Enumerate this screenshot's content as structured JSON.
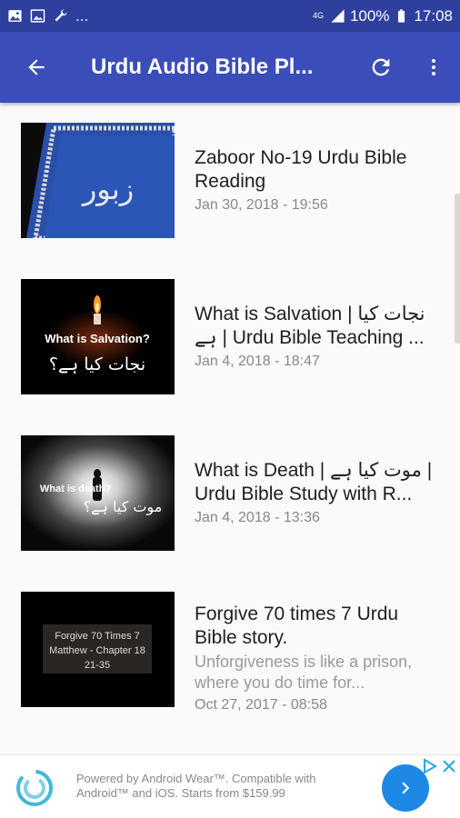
{
  "status_bar": {
    "network": "4G",
    "battery": "100%",
    "time": "17:08",
    "more": "..."
  },
  "app_bar": {
    "title": "Urdu Audio Bible Pl..."
  },
  "videos": [
    {
      "title": "Zaboor No-19 Urdu Bible Reading",
      "date": "Jan 30, 2018 - 19:56",
      "thumb_text": "زبور"
    },
    {
      "title": "What is Salvation | نجات کیا ہے | Urdu Bible Teaching ...",
      "date": "Jan 4, 2018 - 18:47",
      "thumb_text": "What is Salvation?",
      "thumb_text2": "نجات کیا ہے؟"
    },
    {
      "title": "What is Death | موت کیا ہے | Urdu Bible Study with R...",
      "date": "Jan 4, 2018 - 13:36",
      "thumb_text": "What is death?",
      "thumb_text2": "موت کیا ہے؟"
    },
    {
      "title": "Forgive 70 times 7 Urdu Bible story.",
      "description": "Unforgiveness is like a prison, where you do time for...",
      "date": "Oct 27, 2017 - 08:58",
      "thumb_lines": [
        "Forgive 70 Times 7",
        "Matthew - Chapter 18",
        "21-35"
      ]
    }
  ],
  "ad": {
    "text": "Powered by Android Wear™. Compatible with Android™ and iOS. Starts from $159.99"
  },
  "colors": {
    "status_bar": "#2f3f9e",
    "app_bar": "#3b4db8",
    "ad_button": "#1e88e5"
  }
}
